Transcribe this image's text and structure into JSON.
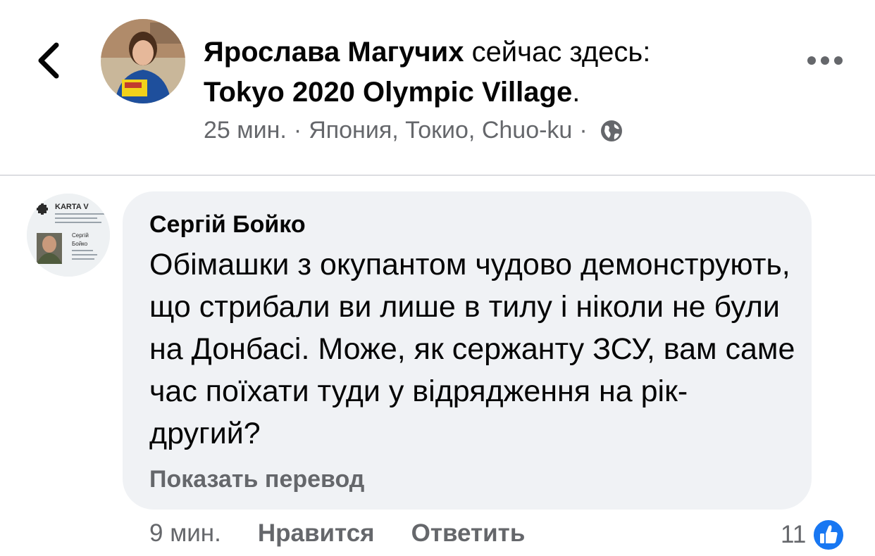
{
  "post": {
    "author": "Ярослава Магучих",
    "status_text": "сейчас здесь:",
    "place": "Tokyo 2020 Olympic Village",
    "place_suffix": ".",
    "time": "25 мин.",
    "separator": "·",
    "location": "Япония, Токио, Chuo-ku",
    "privacy_icon": "globe-icon"
  },
  "comment": {
    "author": "Сергій Бойко",
    "text": "Обімашки з окупантом чудово демонструють, що стрибали ви лише в тилу і ніколи не були на Донбасі. Може, як сержанту ЗСУ, вам саме час поїхати туди у відрядження на рік-другий?",
    "translate_label": "Показать перевод",
    "time": "9 мин.",
    "like_label": "Нравится",
    "reply_label": "Ответить",
    "reaction_count": "11",
    "avatar_card_title": "KARTA V",
    "avatar_card_name": "Сергій",
    "avatar_card_surname": "Бойко"
  },
  "colors": {
    "accent": "#1877f2",
    "secondary_text": "#65676b",
    "bubble_bg": "#f0f2f5"
  }
}
